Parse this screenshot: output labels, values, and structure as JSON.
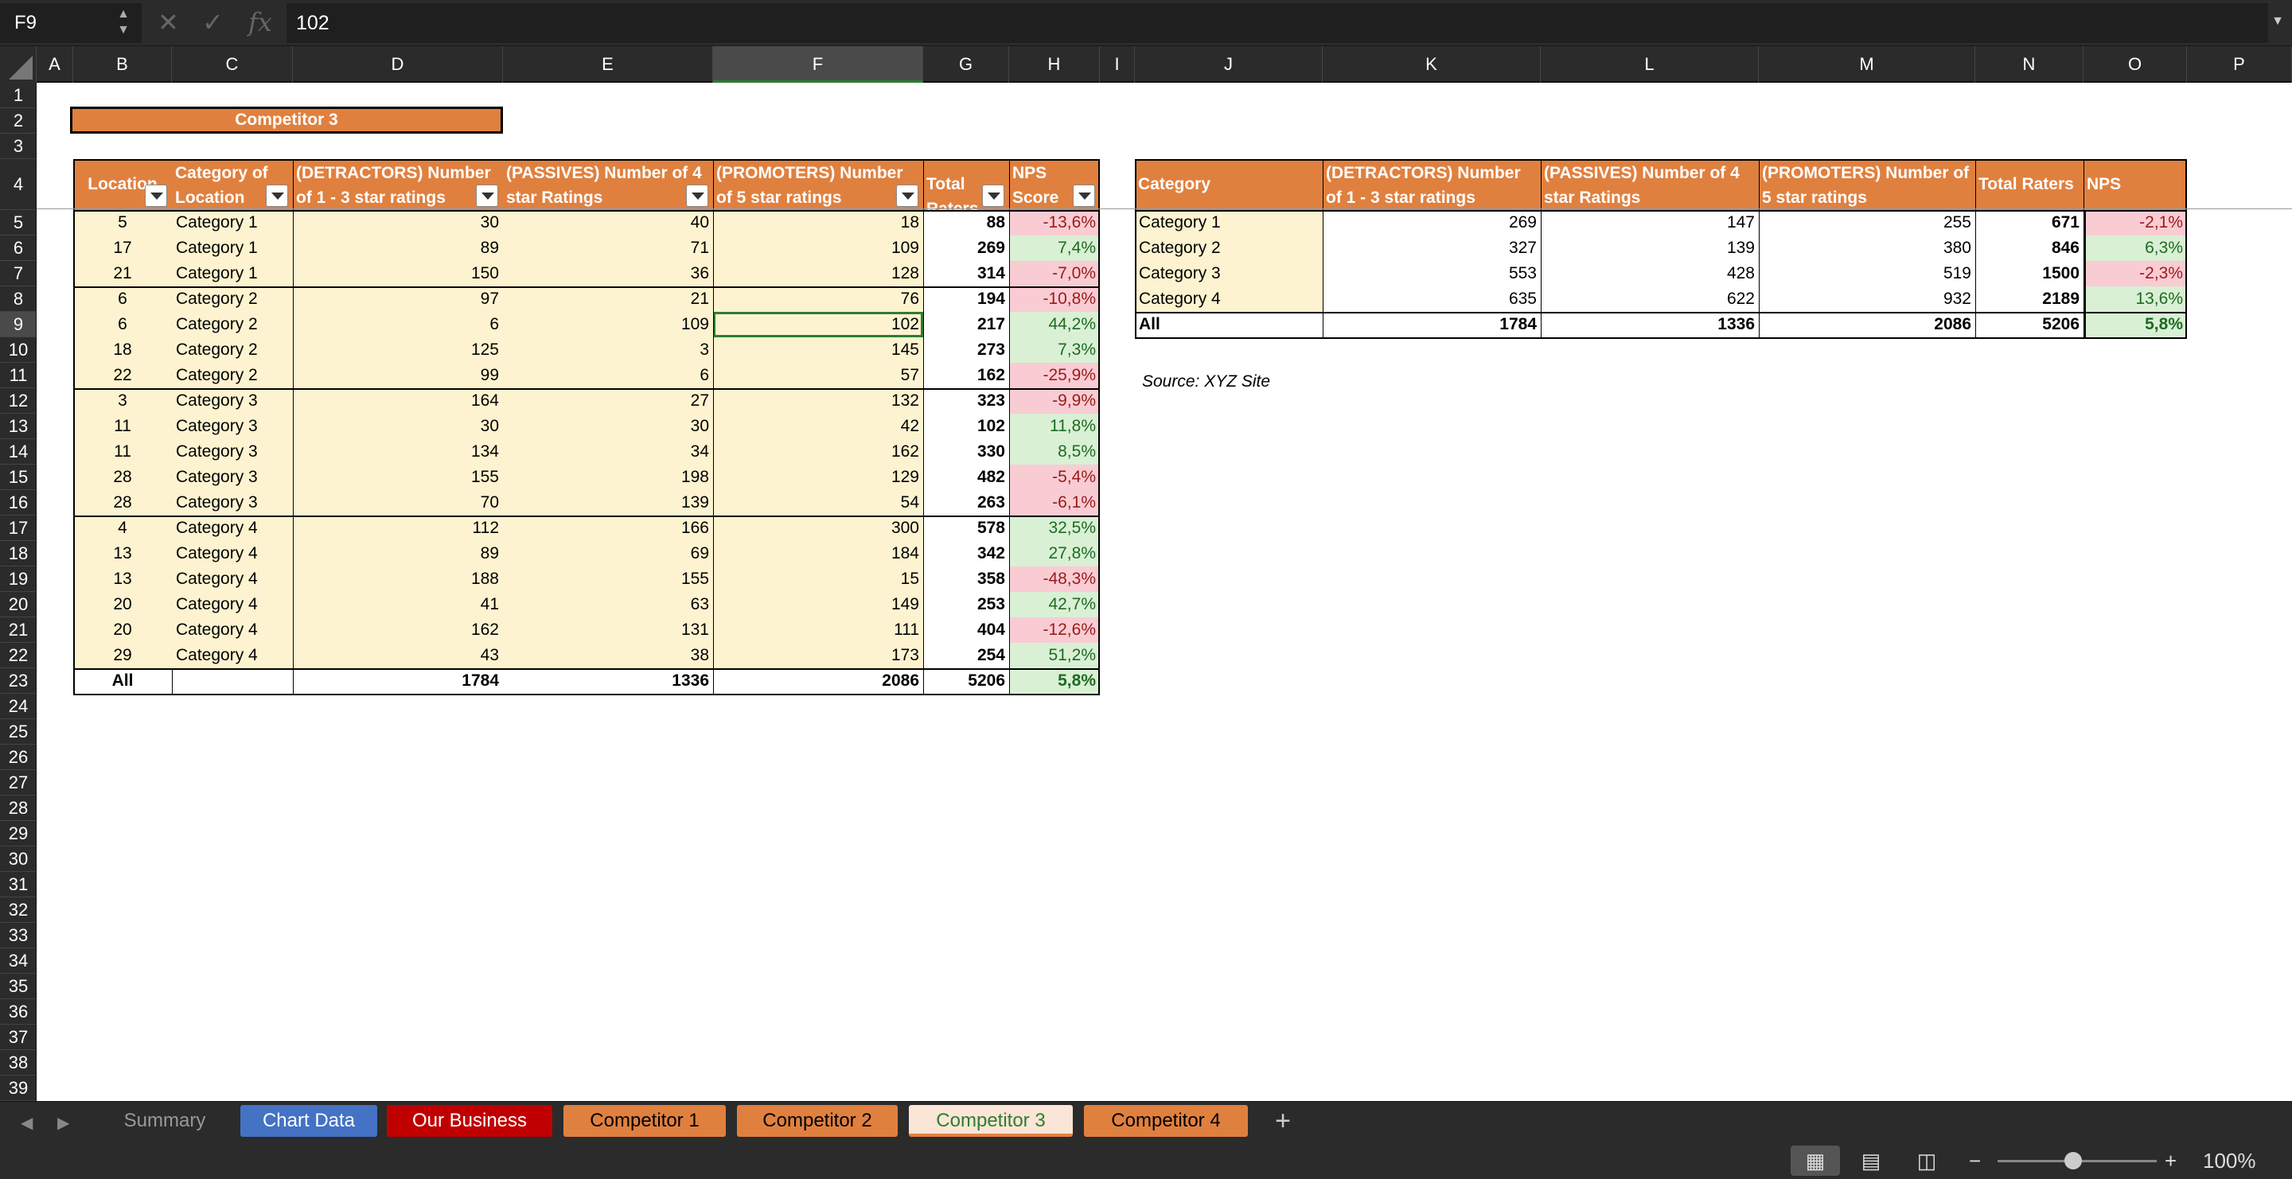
{
  "formula_bar": {
    "cell_ref": "F9",
    "content": "102",
    "fx": "fx",
    "cancel": "✕",
    "confirm": "✓"
  },
  "columns": [
    "A",
    "B",
    "C",
    "D",
    "E",
    "F",
    "G",
    "H",
    "I",
    "J",
    "K",
    "L",
    "M",
    "N",
    "O",
    "P"
  ],
  "rows": [
    "1",
    "2",
    "3",
    "4",
    "5",
    "6",
    "7",
    "8",
    "9",
    "10",
    "11",
    "12",
    "13",
    "14",
    "15",
    "16",
    "17",
    "18",
    "19",
    "20",
    "21",
    "22",
    "23",
    "24",
    "25",
    "26",
    "27",
    "28",
    "29",
    "30",
    "31",
    "32",
    "33",
    "34",
    "35",
    "36",
    "37",
    "38",
    "39"
  ],
  "title": "Competitor 3",
  "left_table": {
    "headers": [
      "Location",
      "Category of Location",
      "(DETRACTORS) Number of 1 - 3 star ratings",
      "(PASSIVES) Number of 4 star Ratings",
      "(PROMOTERS) Number of 5 star ratings",
      "Total Raters",
      "NPS Score"
    ],
    "rows": [
      [
        "5",
        "Category 1",
        "30",
        "40",
        "18",
        "88",
        "-13,6%"
      ],
      [
        "17",
        "Category 1",
        "89",
        "71",
        "109",
        "269",
        "7,4%"
      ],
      [
        "21",
        "Category 1",
        "150",
        "36",
        "128",
        "314",
        "-7,0%"
      ],
      [
        "6",
        "Category 2",
        "97",
        "21",
        "76",
        "194",
        "-10,8%"
      ],
      [
        "6",
        "Category 2",
        "6",
        "109",
        "102",
        "217",
        "44,2%"
      ],
      [
        "18",
        "Category 2",
        "125",
        "3",
        "145",
        "273",
        "7,3%"
      ],
      [
        "22",
        "Category 2",
        "99",
        "6",
        "57",
        "162",
        "-25,9%"
      ],
      [
        "3",
        "Category 3",
        "164",
        "27",
        "132",
        "323",
        "-9,9%"
      ],
      [
        "11",
        "Category 3",
        "30",
        "30",
        "42",
        "102",
        "11,8%"
      ],
      [
        "11",
        "Category 3",
        "134",
        "34",
        "162",
        "330",
        "8,5%"
      ],
      [
        "28",
        "Category 3",
        "155",
        "198",
        "129",
        "482",
        "-5,4%"
      ],
      [
        "28",
        "Category 3",
        "70",
        "139",
        "54",
        "263",
        "-6,1%"
      ],
      [
        "4",
        "Category 4",
        "112",
        "166",
        "300",
        "578",
        "32,5%"
      ],
      [
        "13",
        "Category 4",
        "89",
        "69",
        "184",
        "342",
        "27,8%"
      ],
      [
        "13",
        "Category 4",
        "188",
        "155",
        "15",
        "358",
        "-48,3%"
      ],
      [
        "20",
        "Category 4",
        "41",
        "63",
        "149",
        "253",
        "42,7%"
      ],
      [
        "20",
        "Category 4",
        "162",
        "131",
        "111",
        "404",
        "-12,6%"
      ],
      [
        "29",
        "Category 4",
        "43",
        "38",
        "173",
        "254",
        "51,2%"
      ]
    ],
    "total": [
      "All",
      "",
      "1784",
      "1336",
      "2086",
      "5206",
      "5,8%"
    ]
  },
  "right_table": {
    "headers": [
      "Category",
      "(DETRACTORS) Number of 1 - 3 star ratings",
      "(PASSIVES) Number of 4 star Ratings",
      "(PROMOTERS) Number of 5 star ratings",
      "Total Raters",
      "NPS"
    ],
    "rows": [
      [
        "Category 1",
        "269",
        "147",
        "255",
        "671",
        "-2,1%"
      ],
      [
        "Category 2",
        "327",
        "139",
        "380",
        "846",
        "6,3%"
      ],
      [
        "Category 3",
        "553",
        "428",
        "519",
        "1500",
        "-2,3%"
      ],
      [
        "Category 4",
        "635",
        "622",
        "932",
        "2189",
        "13,6%"
      ]
    ],
    "total": [
      "All",
      "1784",
      "1336",
      "2086",
      "5206",
      "5,8%"
    ]
  },
  "source": "Source: XYZ Site",
  "sheet_tabs": [
    "Summary",
    "Chart Data",
    "Our Business",
    "Competitor 1",
    "Competitor 2",
    "Competitor 3",
    "Competitor 4"
  ],
  "add_sheet": "+",
  "zoom": {
    "minus": "−",
    "plus": "+",
    "level": "100%"
  },
  "colors": {
    "accent": "#e0803f",
    "cream": "#fdf3d0",
    "positive": "#d9f0d5",
    "negative": "#f9ccd3",
    "selection": "#2e7d32"
  }
}
